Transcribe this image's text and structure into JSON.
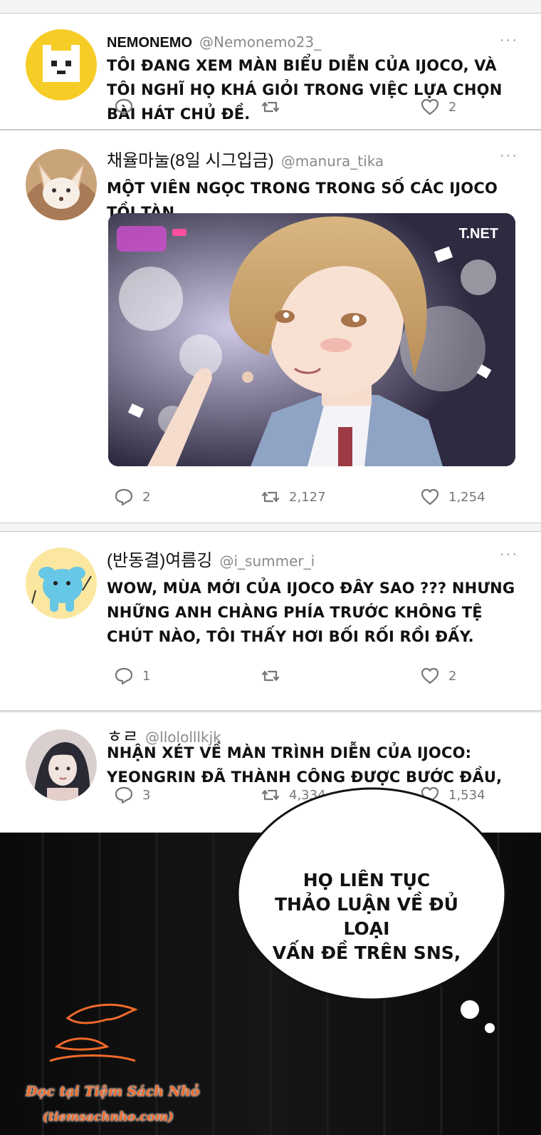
{
  "tweets": [
    {
      "name": "NEMONEMO",
      "handle": "@Nemonemo23_",
      "text": "TÔI ĐANG XEM MÀN BIỂU DIỄN CỦA IJOCO, VÀ TÔI NGHĨ HỌ KHÁ GIỎI TRONG VIỆC LỰA CHỌN BÀI HÁT CHỦ ĐỀ.",
      "replies": "",
      "retweets": "",
      "likes": "2",
      "more": "···"
    },
    {
      "name": "채율마눌(8일 시그입금)",
      "handle": "@manura_tika",
      "text": "MỘT VIÊN NGỌC TRONG TRONG SỐ CÁC IJOCO TỒI TÀN",
      "media_tag": "T.NET",
      "replies": "2",
      "retweets": "2,127",
      "likes": "1,254",
      "more": "···"
    },
    {
      "name": "(반동결)여름깅",
      "handle": "@i_summer_i",
      "text": "WOW, MÙA MỚI CỦA IJOCO ĐÂY SAO ??? NHƯNG NHỮNG ANH CHÀNG PHÍA TRƯỚC KHÔNG TỆ CHÚT NÀO, TÔI THẤY HƠI BỐI RỐI RỒI ĐẤY.",
      "replies": "1",
      "retweets": "",
      "likes": "2",
      "more": "···"
    },
    {
      "name": "ㅎㄹ",
      "handle": "@llololllkjk",
      "text": "NHẬN XÉT VỀ MÀN TRÌNH DIỄN CỦA IJOCO: YEONGRIN ĐÃ THÀNH CÔNG ĐƯỢC BƯỚC ĐẦU,",
      "replies": "3",
      "retweets": "4,334",
      "likes": "1,534"
    }
  ],
  "speech_bubble": {
    "line1": "HỌ LIÊN TỤC",
    "line2": "THẢO LUẬN VỀ ĐỦ LOẠI",
    "line3": "VẤN ĐỀ TRÊN SNS,"
  },
  "watermark": {
    "line1": "Đọc tại Tiệm Sách Nhỏ",
    "line2": "(tiemsachnho.com)"
  },
  "icons": [
    "reply-icon",
    "retweet-icon",
    "like-icon",
    "more-icon"
  ],
  "colors": {
    "background": "#f4f4f4",
    "card": "#ffffff",
    "muted": "#8a8a8a",
    "watermark": "#f06a2a",
    "comic_bg": "#060606"
  }
}
